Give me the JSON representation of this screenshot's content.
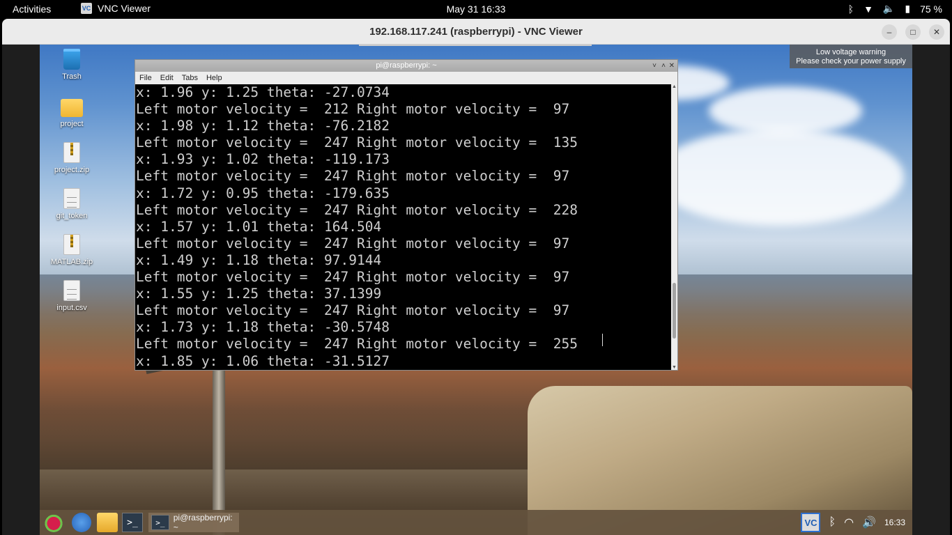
{
  "topbar": {
    "activities": "Activities",
    "app_icon": "VC",
    "app_name": "VNC Viewer",
    "clock": "May 31  16:33",
    "battery": "75 %",
    "icons": [
      "bing-icon",
      "wifi-icon",
      "volume-icon",
      "battery-icon"
    ]
  },
  "vnc": {
    "title": "192.168.117.241 (raspberrypi) - VNC Viewer",
    "controls": {
      "minimize": "–",
      "maximize": "□",
      "close": "✕"
    }
  },
  "desktop": {
    "icons": [
      {
        "label": "Trash"
      },
      {
        "label": "project"
      },
      {
        "label": "project.zip"
      },
      {
        "label": "git_token"
      },
      {
        "label": "MATLAB.zip"
      },
      {
        "label": "input.csv"
      }
    ],
    "warning": {
      "line1": "Low voltage warning",
      "line2": "Please check your power supply"
    }
  },
  "terminal": {
    "title": "pi@raspberrypi: ~",
    "controls": {
      "min": "˅",
      "max": "˄",
      "close": "✕"
    },
    "menu": [
      "File",
      "Edit",
      "Tabs",
      "Help"
    ],
    "lines": [
      "x: 1.96 y: 1.25 theta: -27.0734",
      "Left motor velocity =  212 Right motor velocity =  97",
      "x: 1.98 y: 1.12 theta: -76.2182",
      "Left motor velocity =  247 Right motor velocity =  135",
      "x: 1.93 y: 1.02 theta: -119.173",
      "Left motor velocity =  247 Right motor velocity =  97",
      "x: 1.72 y: 0.95 theta: -179.635",
      "Left motor velocity =  247 Right motor velocity =  228",
      "x: 1.57 y: 1.01 theta: 164.504",
      "Left motor velocity =  247 Right motor velocity =  97",
      "x: 1.49 y: 1.18 theta: 97.9144",
      "Left motor velocity =  247 Right motor velocity =  97",
      "x: 1.55 y: 1.25 theta: 37.1399",
      "Left motor velocity =  247 Right motor velocity =  97",
      "x: 1.73 y: 1.18 theta: -30.5748",
      "Left motor velocity =  247 Right motor velocity =  255",
      "x: 1.85 y: 1.06 theta: -31.5127"
    ]
  },
  "taskbar": {
    "terminal_glyph": ">_",
    "task_label": "pi@raspberrypi: ~",
    "vnc_icon": "VC",
    "time": "16:33",
    "icons": [
      "raspberry-menu-icon",
      "browser-icon",
      "file-manager-icon",
      "terminal-icon",
      "vnc-tray-icon",
      "bluetooth-icon",
      "wifi-icon",
      "volume-icon"
    ]
  }
}
